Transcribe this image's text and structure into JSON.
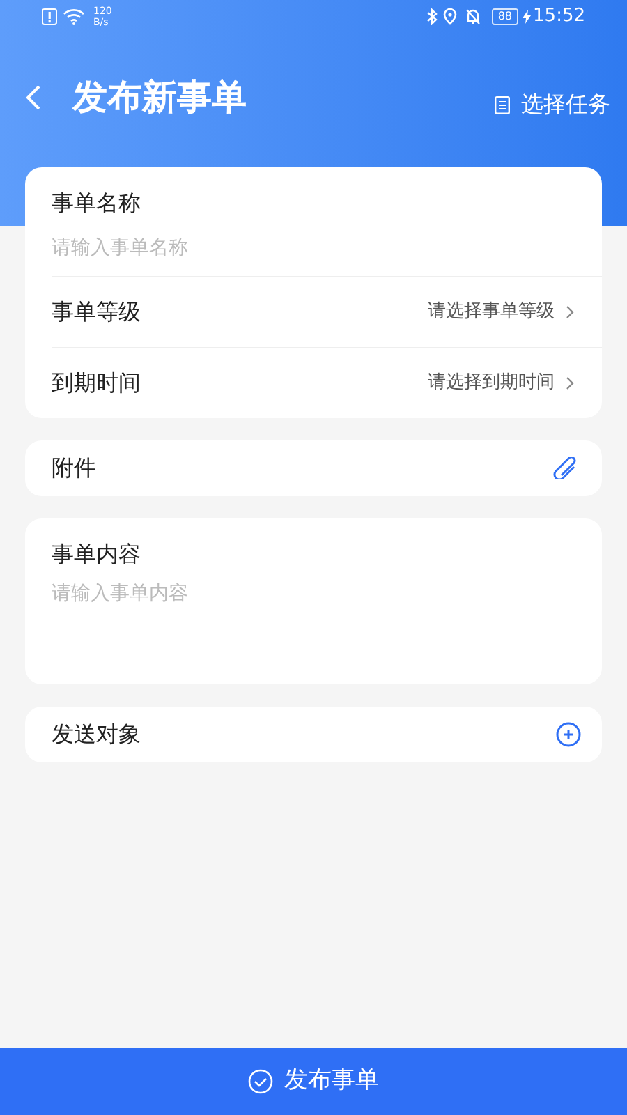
{
  "status_bar": {
    "speed": "120",
    "speed_unit": "B/s",
    "battery": "88",
    "time": "15:52"
  },
  "header": {
    "title": "发布新事单",
    "action": "选择任务"
  },
  "form": {
    "name": {
      "label": "事单名称",
      "placeholder": "请输入事单名称"
    },
    "rows": [
      {
        "label": "事单等级",
        "value": "请选择事单等级"
      },
      {
        "label": "到期时间",
        "value": "请选择到期时间"
      }
    ]
  },
  "attachment": {
    "label": "附件"
  },
  "content": {
    "label": "事单内容",
    "placeholder": "请输入事单内容"
  },
  "recipients": {
    "label": "发送对象"
  },
  "submit": {
    "label": "发布事单"
  }
}
